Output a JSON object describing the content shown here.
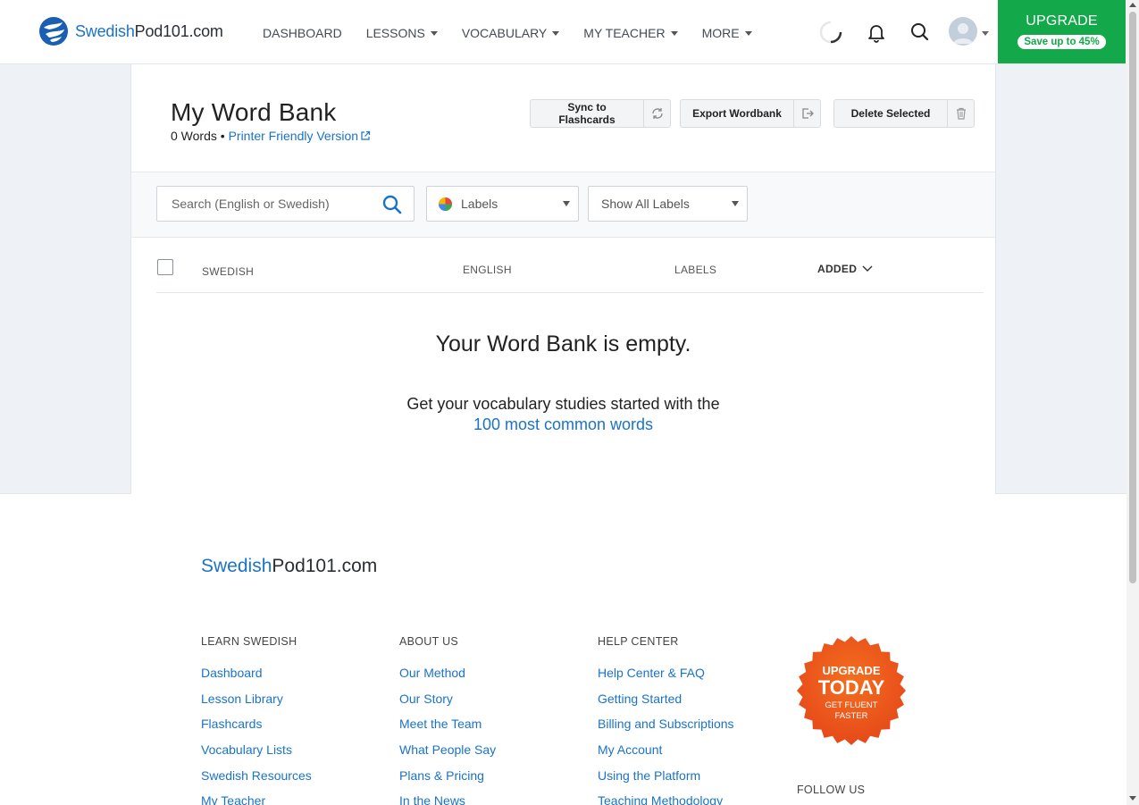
{
  "header": {
    "logo": {
      "part1": "Swedish",
      "part2": "Pod101.com"
    },
    "nav": [
      "DASHBOARD",
      "LESSONS",
      "VOCABULARY",
      "MY TEACHER",
      "MORE"
    ],
    "upgrade": {
      "title": "UPGRADE",
      "subtitle": "Save up to 45%"
    }
  },
  "page": {
    "title": "My Word Bank",
    "word_count": "0 Words",
    "separator": "•",
    "printer_link": "Printer Friendly Version",
    "buttons": {
      "sync": "Sync to Flashcards",
      "export": "Export Wordbank",
      "delete": "Delete Selected"
    }
  },
  "filters": {
    "search_placeholder": "Search (English or Swedish)",
    "labels_select": "Labels",
    "show_labels_select": "Show All Labels"
  },
  "table": {
    "columns": [
      "SWEDISH",
      "ENGLISH",
      "LABELS",
      "ADDED"
    ]
  },
  "empty_state": {
    "title": "Your Word Bank is empty.",
    "text": "Get your vocabulary studies started with the",
    "link": "100 most common words"
  },
  "footer": {
    "logo": {
      "part1": "Swedish",
      "part2": "Pod101.com"
    },
    "columns": [
      {
        "heading": "LEARN SWEDISH",
        "links": [
          "Dashboard",
          "Lesson Library",
          "Flashcards",
          "Vocabulary Lists",
          "Swedish Resources",
          "My Teacher"
        ]
      },
      {
        "heading": "ABOUT US",
        "links": [
          "Our Method",
          "Our Story",
          "Meet the Team",
          "What People Say",
          "Plans & Pricing",
          "In the News"
        ]
      },
      {
        "heading": "HELP CENTER",
        "links": [
          "Help Center & FAQ",
          "Getting Started",
          "Billing and Subscriptions",
          "My Account",
          "Using the Platform",
          "Teaching Methodology"
        ]
      }
    ],
    "badge": {
      "line1": "UPGRADE",
      "line2": "TODAY",
      "line3": "GET FLUENT",
      "line4": "FASTER"
    },
    "follow_us": "FOLLOW US"
  },
  "colors": {
    "brand_blue": "#1a73c8",
    "upgrade_green": "#13a84a",
    "badge_orange": "#f2611d"
  }
}
